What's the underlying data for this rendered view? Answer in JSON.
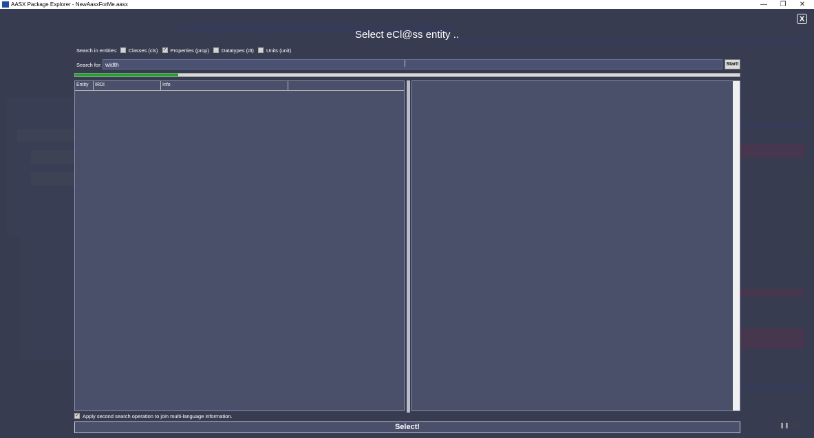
{
  "window": {
    "title": "AASX Package Explorer - NewAasxForMe.aasx",
    "minimize": "—",
    "maximize": "❐",
    "close": "✕"
  },
  "dialog": {
    "title": "Select eCl@ss entity ..",
    "close_label": "X",
    "search_in_label": "Search in entities:",
    "entity_options": [
      {
        "label": "Classes (cls)",
        "checked": false
      },
      {
        "label": "Properties (prop)",
        "checked": true
      },
      {
        "label": "Datatypes (dt)",
        "checked": false
      },
      {
        "label": "Units (unit)",
        "checked": false
      }
    ],
    "search_for_label": "Search for:",
    "search_value": "width",
    "start_label": "Start!",
    "progress_fraction": 0.155,
    "columns": [
      "Entity",
      "IRDI",
      "Info",
      ""
    ],
    "apply_label": "Apply second search operation to join multi-language information.",
    "apply_checked": true,
    "select_label": "Select!"
  },
  "colors": {
    "progress": "#1ea32a",
    "overlay": "#2d3042"
  },
  "icons": {
    "checkmark": "✓",
    "pause": "❚❚"
  }
}
